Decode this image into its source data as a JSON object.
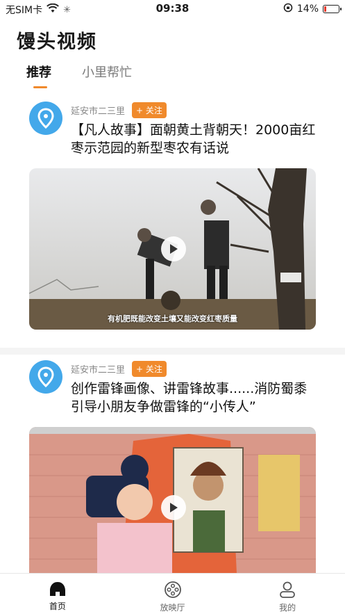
{
  "status_bar": {
    "carrier": "无SIM卡",
    "time": "09:38",
    "battery_percent": "14%",
    "battery_level": 0.14,
    "battery_color": "#e63b2e"
  },
  "header": {
    "app_title": "馒头视频",
    "tabs": [
      {
        "label": "推荐",
        "active": true
      },
      {
        "label": "小里帮忙",
        "active": false
      }
    ]
  },
  "colors": {
    "accent": "#f08a2c",
    "avatar": "#43a8ea"
  },
  "feed": [
    {
      "author": "延安市二三里",
      "follow_label": "+ 关注",
      "title": "【凡人故事】面朝黄土背朝天！2000亩红枣示范园的新型枣农有话说",
      "video_caption": "有机肥既能改变土壤又能改变红枣质量"
    },
    {
      "author": "延安市二三里",
      "follow_label": "+ 关注",
      "title": "创作雷锋画像、讲雷锋故事......消防蜀黍引导小朋友争做雷锋的“小传人”",
      "video_caption": ""
    }
  ],
  "bottom_nav": [
    {
      "label": "首页",
      "icon": "home-icon",
      "active": true
    },
    {
      "label": "放映厅",
      "icon": "film-reel-icon",
      "active": false
    },
    {
      "label": "我的",
      "icon": "profile-icon",
      "active": false
    }
  ]
}
